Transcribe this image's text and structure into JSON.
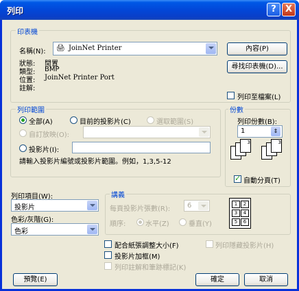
{
  "title": "列印",
  "title_buttons": {
    "help": "?",
    "close": "X"
  },
  "printer": {
    "group": "印表機",
    "name_label": "名稱(N):",
    "name_value": "JoinNet Printer",
    "status_label": "狀態:",
    "status_value": "閒置",
    "type_label": "類型:",
    "type_value": "BMP",
    "where_label": "位置:",
    "where_value": "JoinNet Printer Port",
    "comment_label": "註解:",
    "properties_btn": "內容(P)",
    "find_btn": "尋找印表機(D)...",
    "print_to_file": "列印至檔案(L)"
  },
  "range": {
    "group": "列印範圍",
    "all": "全部(A)",
    "current": "目前的投影片(C)",
    "selection": "選取範圍(S)",
    "custom_show": "自訂放映(O):",
    "slides": "投影片(I):",
    "hint": "請輸入投影片編號或投影片範圍。例如，1,3,5-12"
  },
  "copies": {
    "group": "份數",
    "count_label": "列印份數(B):",
    "count_value": "1",
    "collate": "自動分頁(T)"
  },
  "print_what": {
    "label": "列印項目(W):",
    "value": "投影片"
  },
  "color": {
    "label": "色彩/灰階(G):",
    "value": "色彩"
  },
  "handouts": {
    "group": "講義",
    "per_page_label": "每頁投影片張數(R):",
    "per_page_value": "6",
    "order_label": "順序:",
    "horizontal": "水平(Z)",
    "vertical": "垂直(Y)",
    "preview": [
      "1",
      "2",
      "3",
      "4",
      "5",
      "6"
    ]
  },
  "options": {
    "scale": "配合紙張調整大小(F)",
    "frame": "投影片加框(M)",
    "comments": "列印註解和筆跡標記(K)",
    "hidden": "列印隱藏投影片(H)"
  },
  "footer": {
    "preview": "預覽(E)",
    "ok": "確定",
    "cancel": "取消"
  }
}
